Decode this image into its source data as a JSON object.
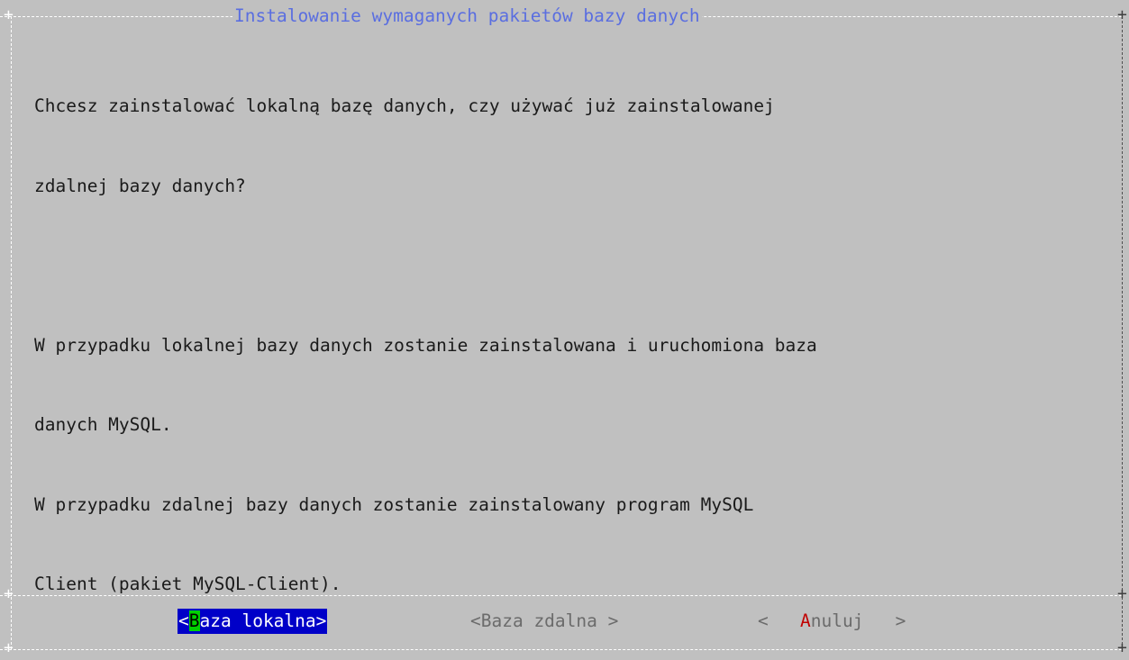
{
  "dialog": {
    "title": "Instalowanie wymaganych pakietów bazy danych",
    "question_line1": "Chcesz zainstalować lokalną bazę danych, czy używać już zainstalowanej",
    "question_line2": "zdalnej bazy danych?",
    "local_line1": "W przypadku lokalnej bazy danych zostanie zainstalowana i uruchomiona baza",
    "local_line2": "danych MySQL.",
    "remote_line1": "W przypadku zdalnej bazy danych zostanie zainstalowany program MySQL",
    "remote_line2": "Client (pakiet MySQL-Client)."
  },
  "buttons": {
    "local": {
      "open": "<",
      "hotkey": "B",
      "rest": "aza lokalna",
      "close": ">"
    },
    "remote": {
      "label": "<Baza zdalna >"
    },
    "cancel": {
      "open": "<   ",
      "hotkey": "A",
      "rest": "nuluj",
      "close": "   >"
    }
  },
  "colors": {
    "background": "#c0c0c0",
    "title": "#5a6ee0",
    "selected_bg": "#0000c8",
    "hotkey_bg": "#00d000",
    "cancel_hotkey": "#c00000",
    "inactive_text": "#6b6b6b"
  }
}
